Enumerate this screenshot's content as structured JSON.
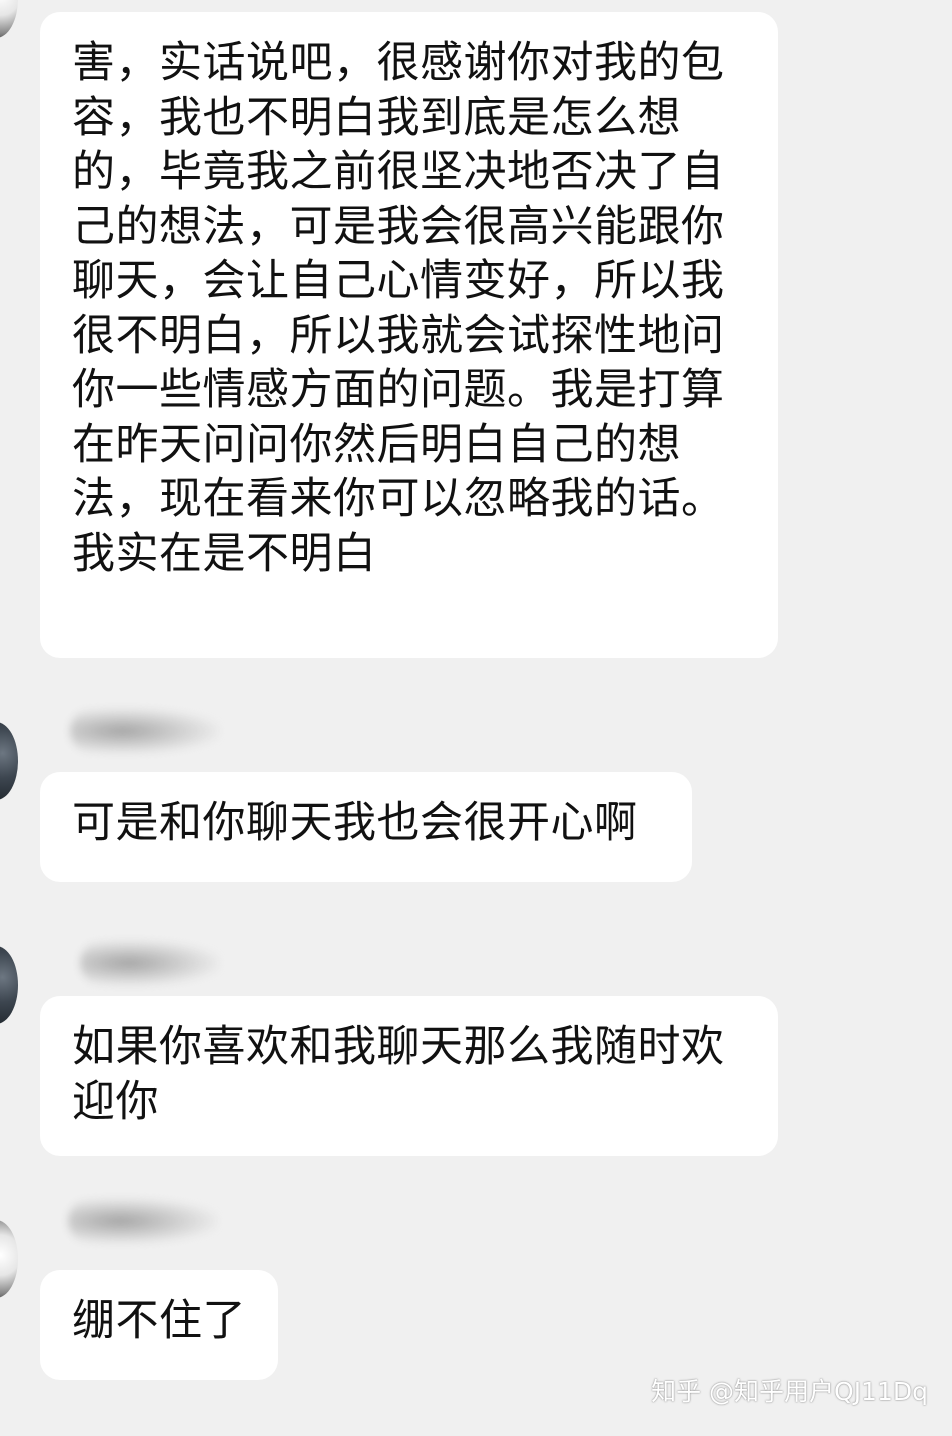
{
  "messages": [
    {
      "text": "害，实话说吧，很感谢你对我的包容，我也不明白我到底是怎么想的，毕竟我之前很坚决地否决了自己的想法，可是我会很高兴能跟你聊天，会让自己心情变好，所以我很不明白，所以我就会试探性地问你一些情感方面的问题。我是打算在昨天问问你然后明白自己的想法，现在看来你可以忽略我的话。我实在是不明白"
    },
    {
      "text": "可是和你聊天我也会很开心啊"
    },
    {
      "text": "如果你喜欢和我聊天那么我随时欢迎你"
    },
    {
      "text": "绷不住了"
    }
  ],
  "watermark": "知乎 @知乎用户QJ11Dq",
  "colors": {
    "background": "#f0f0f0",
    "bubble": "#ffffff",
    "text": "#111111"
  }
}
